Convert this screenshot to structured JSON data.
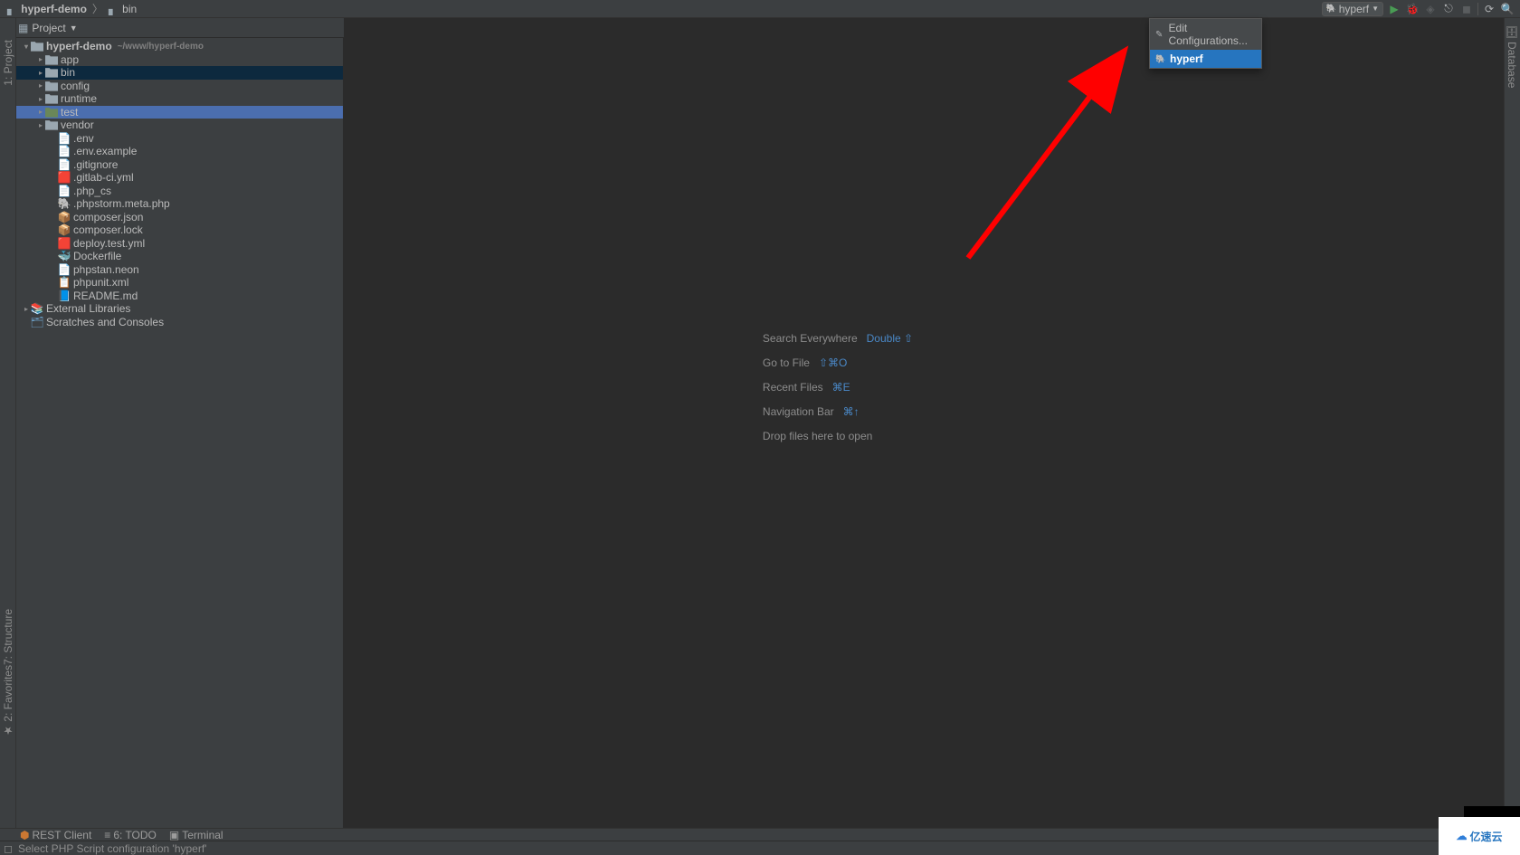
{
  "breadcrumb": {
    "root": "hyperf-demo",
    "child": "bin"
  },
  "run_config": {
    "selected": "hyperf"
  },
  "run_dropdown": {
    "edit_label": "Edit Configurations...",
    "item1": "hyperf"
  },
  "toolbar": {
    "project_label": "Project"
  },
  "left_tabs": {
    "project": "1: Project",
    "structure": "7: Structure",
    "favorites": "2: Favorites"
  },
  "right_tabs": {
    "database": "Database"
  },
  "tree": {
    "root": {
      "name": "hyperf-demo",
      "path": "~/www/hyperf-demo"
    },
    "folders": {
      "app": "app",
      "bin": "bin",
      "config": "config",
      "runtime": "runtime",
      "test": "test",
      "vendor": "vendor"
    },
    "files": {
      "env": ".env",
      "env_example": ".env.example",
      "gitignore": ".gitignore",
      "gitlab": ".gitlab-ci.yml",
      "phpcs": ".php_cs",
      "phpstorm_meta": ".phpstorm.meta.php",
      "composer_json": "composer.json",
      "composer_lock": "composer.lock",
      "deploy": "deploy.test.yml",
      "dockerfile": "Dockerfile",
      "phpstan": "phpstan.neon",
      "phpunit": "phpunit.xml",
      "readme": "README.md"
    },
    "external": "External Libraries",
    "scratches": "Scratches and Consoles"
  },
  "editor_hints": {
    "search": "Search Everywhere",
    "search_key": "Double ⇧",
    "goto": "Go to File",
    "goto_key": "⇧⌘O",
    "recent": "Recent Files",
    "recent_key": "⌘E",
    "nav": "Navigation Bar",
    "nav_key": "⌘↑",
    "drop": "Drop files here to open"
  },
  "bottom": {
    "rest": "REST Client",
    "todo": "6: TODO",
    "terminal": "Terminal"
  },
  "status": {
    "msg": "Select PHP Script configuration 'hyperf'"
  },
  "watermark": "亿速云"
}
